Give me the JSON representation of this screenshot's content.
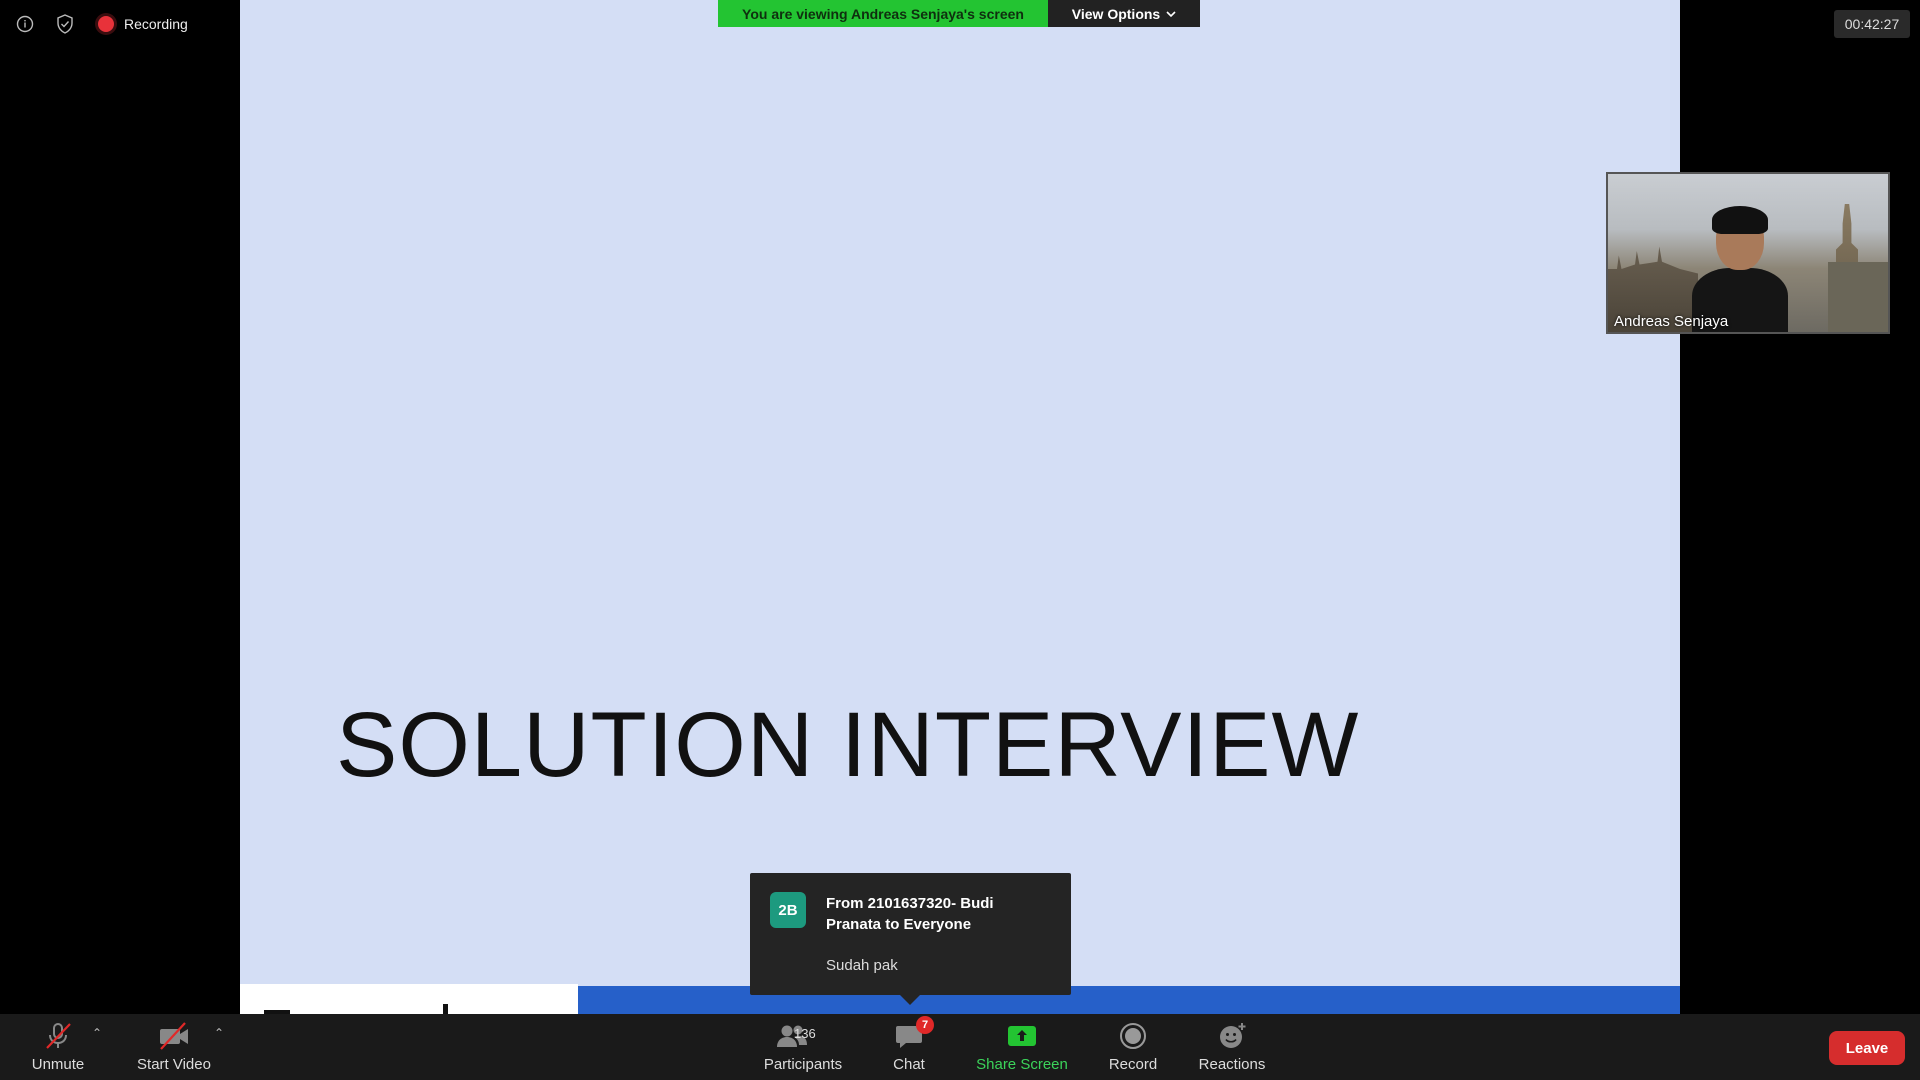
{
  "top_indicators": {
    "recording_label": "Recording"
  },
  "banner": {
    "viewing_text": "You are viewing Andreas Senjaya's screen",
    "view_options_label": "View Options"
  },
  "timer": "00:42:27",
  "slide": {
    "title": "SOLUTION INTERVIEW"
  },
  "video": {
    "participant_name": "Andreas Senjaya"
  },
  "chat_popup": {
    "avatar_initials": "2B",
    "from": "From 2101637320- Budi Pranata to Everyone",
    "message": "Sudah pak"
  },
  "toolbar": {
    "unmute_label": "Unmute",
    "start_video_label": "Start Video",
    "participants_label": "Participants",
    "participants_count": "136",
    "chat_label": "Chat",
    "chat_badge": "7",
    "share_screen_label": "Share Screen",
    "record_label": "Record",
    "reactions_label": "Reactions",
    "leave_label": "Leave"
  },
  "colors": {
    "banner_green": "#23c432",
    "slide_bg": "#d4def5",
    "slide_band_blue": "#2660c9",
    "leave_red": "#d62d2d",
    "share_green": "#3bd35a"
  }
}
